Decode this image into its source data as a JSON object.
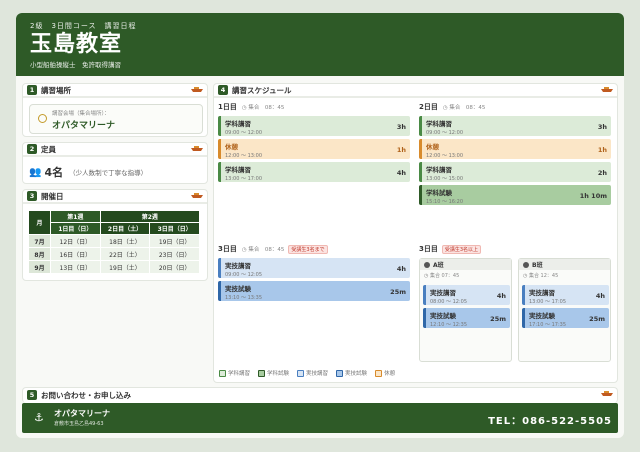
{
  "header": {
    "sub": "2級　3日間コース　講習日程",
    "title": "玉島教室",
    "desc": "小型船舶操縦士　免許取得講習"
  },
  "sections": {
    "place": {
      "num": "1",
      "title": "講習場所",
      "label": "講習会場（集合場所）：",
      "value": "オパタマリーナ"
    },
    "capacity": {
      "num": "2",
      "title": "定員",
      "value": "4名",
      "note": "（少人数制で丁寧な指導）"
    },
    "dates": {
      "num": "3",
      "title": "開催日",
      "head_month": "月",
      "week1": "第1週",
      "week2": "第2週",
      "day1": "1日目（日）",
      "day2": "2日目（土）",
      "day3": "3日目（日）",
      "rows": [
        {
          "m": "7月",
          "d1": "12日（日）",
          "d2": "18日（土）",
          "d3": "19日（日）"
        },
        {
          "m": "8月",
          "d1": "16日（日）",
          "d2": "22日（土）",
          "d3": "23日（日）"
        },
        {
          "m": "9月",
          "d1": "13日（日）",
          "d2": "19日（土）",
          "d3": "20日（日）"
        }
      ]
    },
    "schedule": {
      "num": "4",
      "title": "講習スケジュール"
    },
    "contact": {
      "num": "5",
      "title": "お問い合わせ・お申し込み"
    }
  },
  "schedule": {
    "day1": {
      "label": "1日目",
      "meet": "◷ 集合　08：45",
      "blocks": [
        {
          "t": "学科講習",
          "tm": "09:00 ～ 12:00",
          "d": "3h"
        },
        {
          "t": "休憩",
          "tm": "12:00 ～ 13:00",
          "d": "1h"
        },
        {
          "t": "学科講習",
          "tm": "13:00 ～ 17:00",
          "d": "4h"
        }
      ]
    },
    "day2": {
      "label": "2日目",
      "meet": "◷ 集合　08：45",
      "blocks": [
        {
          "t": "学科講習",
          "tm": "09:00 ～ 12:00",
          "d": "3h"
        },
        {
          "t": "休憩",
          "tm": "12:00 ～ 13:00",
          "d": "1h"
        },
        {
          "t": "学科講習",
          "tm": "13:00 ～ 15:00",
          "d": "2h"
        },
        {
          "t": "学科試験",
          "tm": "15:10 ～ 16:20",
          "d": "1h 10m"
        }
      ]
    },
    "day3a": {
      "label": "3日目",
      "meet": "◷ 集合　08：45",
      "tag": "受講生3名まで",
      "blocks": [
        {
          "t": "実技講習",
          "tm": "09:00 ～ 12:05",
          "d": "4h"
        },
        {
          "t": "実技試験",
          "tm": "13:10 ～ 13:35",
          "d": "25m"
        }
      ]
    },
    "day3b": {
      "label": "3日目",
      "tag": "受講生3名以上",
      "groupA": {
        "name": "A班",
        "meet": "◷ 集合 07：45",
        "blocks": [
          {
            "t": "実技講習",
            "tm": "08:00 ～ 12:05",
            "d": "4h"
          },
          {
            "t": "実技試験",
            "tm": "12:10 ～ 12:35",
            "d": "25m"
          }
        ]
      },
      "groupB": {
        "name": "B班",
        "meet": "◷ 集合 12：45",
        "blocks": [
          {
            "t": "実技講習",
            "tm": "13:00 ～ 17:05",
            "d": "4h"
          },
          {
            "t": "実技試験",
            "tm": "17:10 ～ 17:35",
            "d": "25m"
          }
        ]
      }
    },
    "legend": [
      "学科講習",
      "学科試験",
      "実技講習",
      "実技試験",
      "休憩"
    ]
  },
  "footer": {
    "name": "オパタマリーナ",
    "address": "倉敷市玉島乙島49-63",
    "tel": "TEL：086-522-5505"
  },
  "colors": {
    "primary": "#2e5a27",
    "accent": "#d88b2c"
  }
}
